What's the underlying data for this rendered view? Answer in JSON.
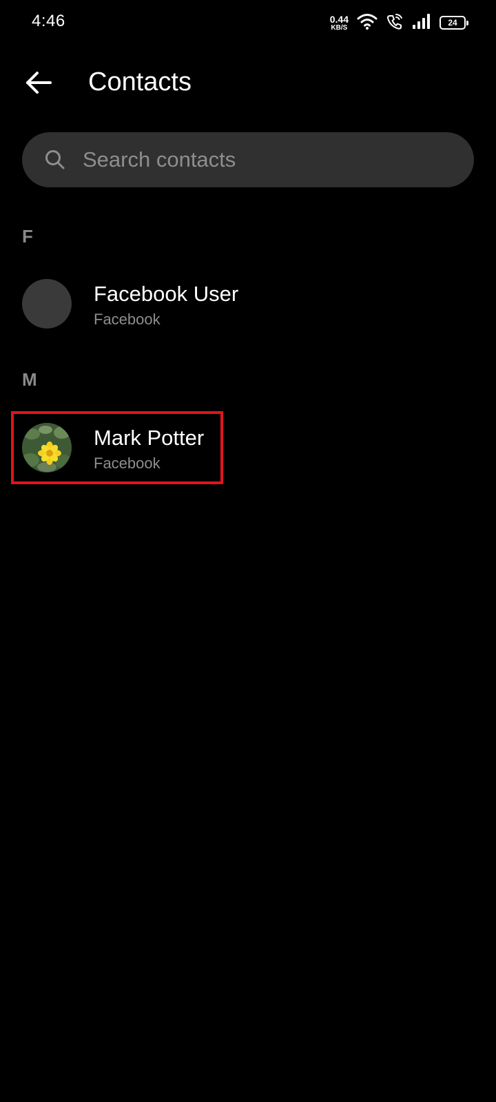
{
  "status_bar": {
    "time": "4:46",
    "net_speed_value": "0.44",
    "net_speed_unit": "KB/S",
    "battery_level": "24",
    "icons": [
      "wifi-icon",
      "wifi-calling-icon",
      "cellular-signal-icon",
      "battery-icon"
    ]
  },
  "header": {
    "back_icon": "arrow-left-icon",
    "title": "Contacts"
  },
  "search": {
    "icon": "search-icon",
    "value": "",
    "placeholder": "Search contacts"
  },
  "sections": [
    {
      "letter": "F",
      "contacts": [
        {
          "name": "Facebook User",
          "source": "Facebook",
          "avatar": "default-avatar"
        }
      ]
    },
    {
      "letter": "M",
      "contacts": [
        {
          "name": "Mark Potter",
          "source": "Facebook",
          "avatar": "yellow-flower-photo"
        }
      ]
    }
  ],
  "colors": {
    "background": "#000000",
    "search_background": "#303030",
    "secondary_text": "#8e8e8e",
    "highlight": "#e0141b"
  }
}
